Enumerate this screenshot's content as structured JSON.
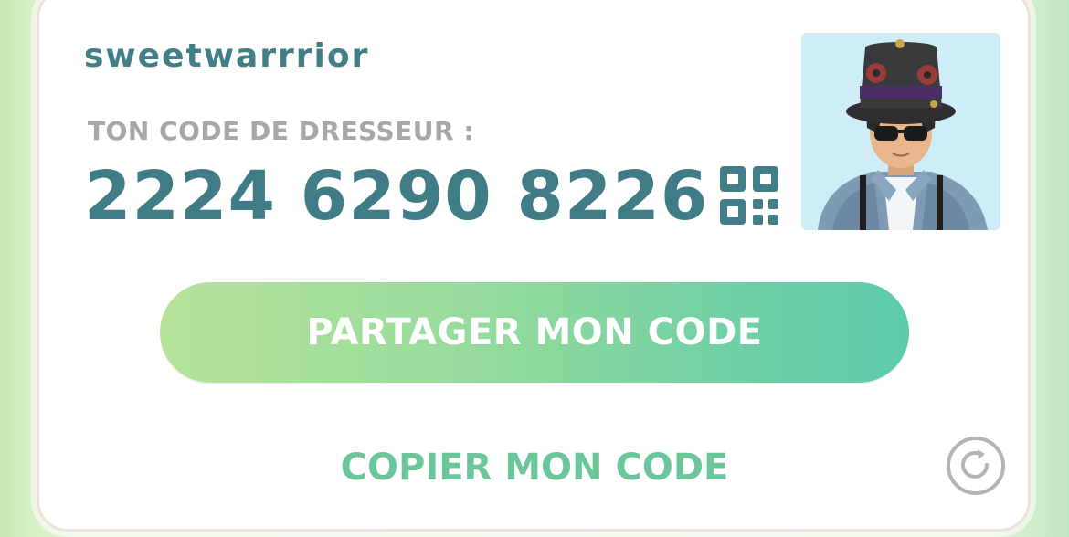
{
  "profile": {
    "username": "sweetwarrrior",
    "code_label": "TON CODE DE DRESSEUR :",
    "trainer_code": "2224 6290 8226"
  },
  "icons": {
    "qr": "qr-code-icon",
    "refresh": "refresh-icon",
    "avatar": "trainer-avatar"
  },
  "actions": {
    "share_label": "PARTAGER MON CODE",
    "copy_label": "COPIER MON CODE"
  },
  "colors": {
    "primary_text": "#427e87",
    "label_gray": "#a7a7a7",
    "share_gradient_start": "#b6e29b",
    "share_gradient_end": "#5ecbae",
    "copy_text": "#6cc69b",
    "card_border": "#f3dede"
  }
}
